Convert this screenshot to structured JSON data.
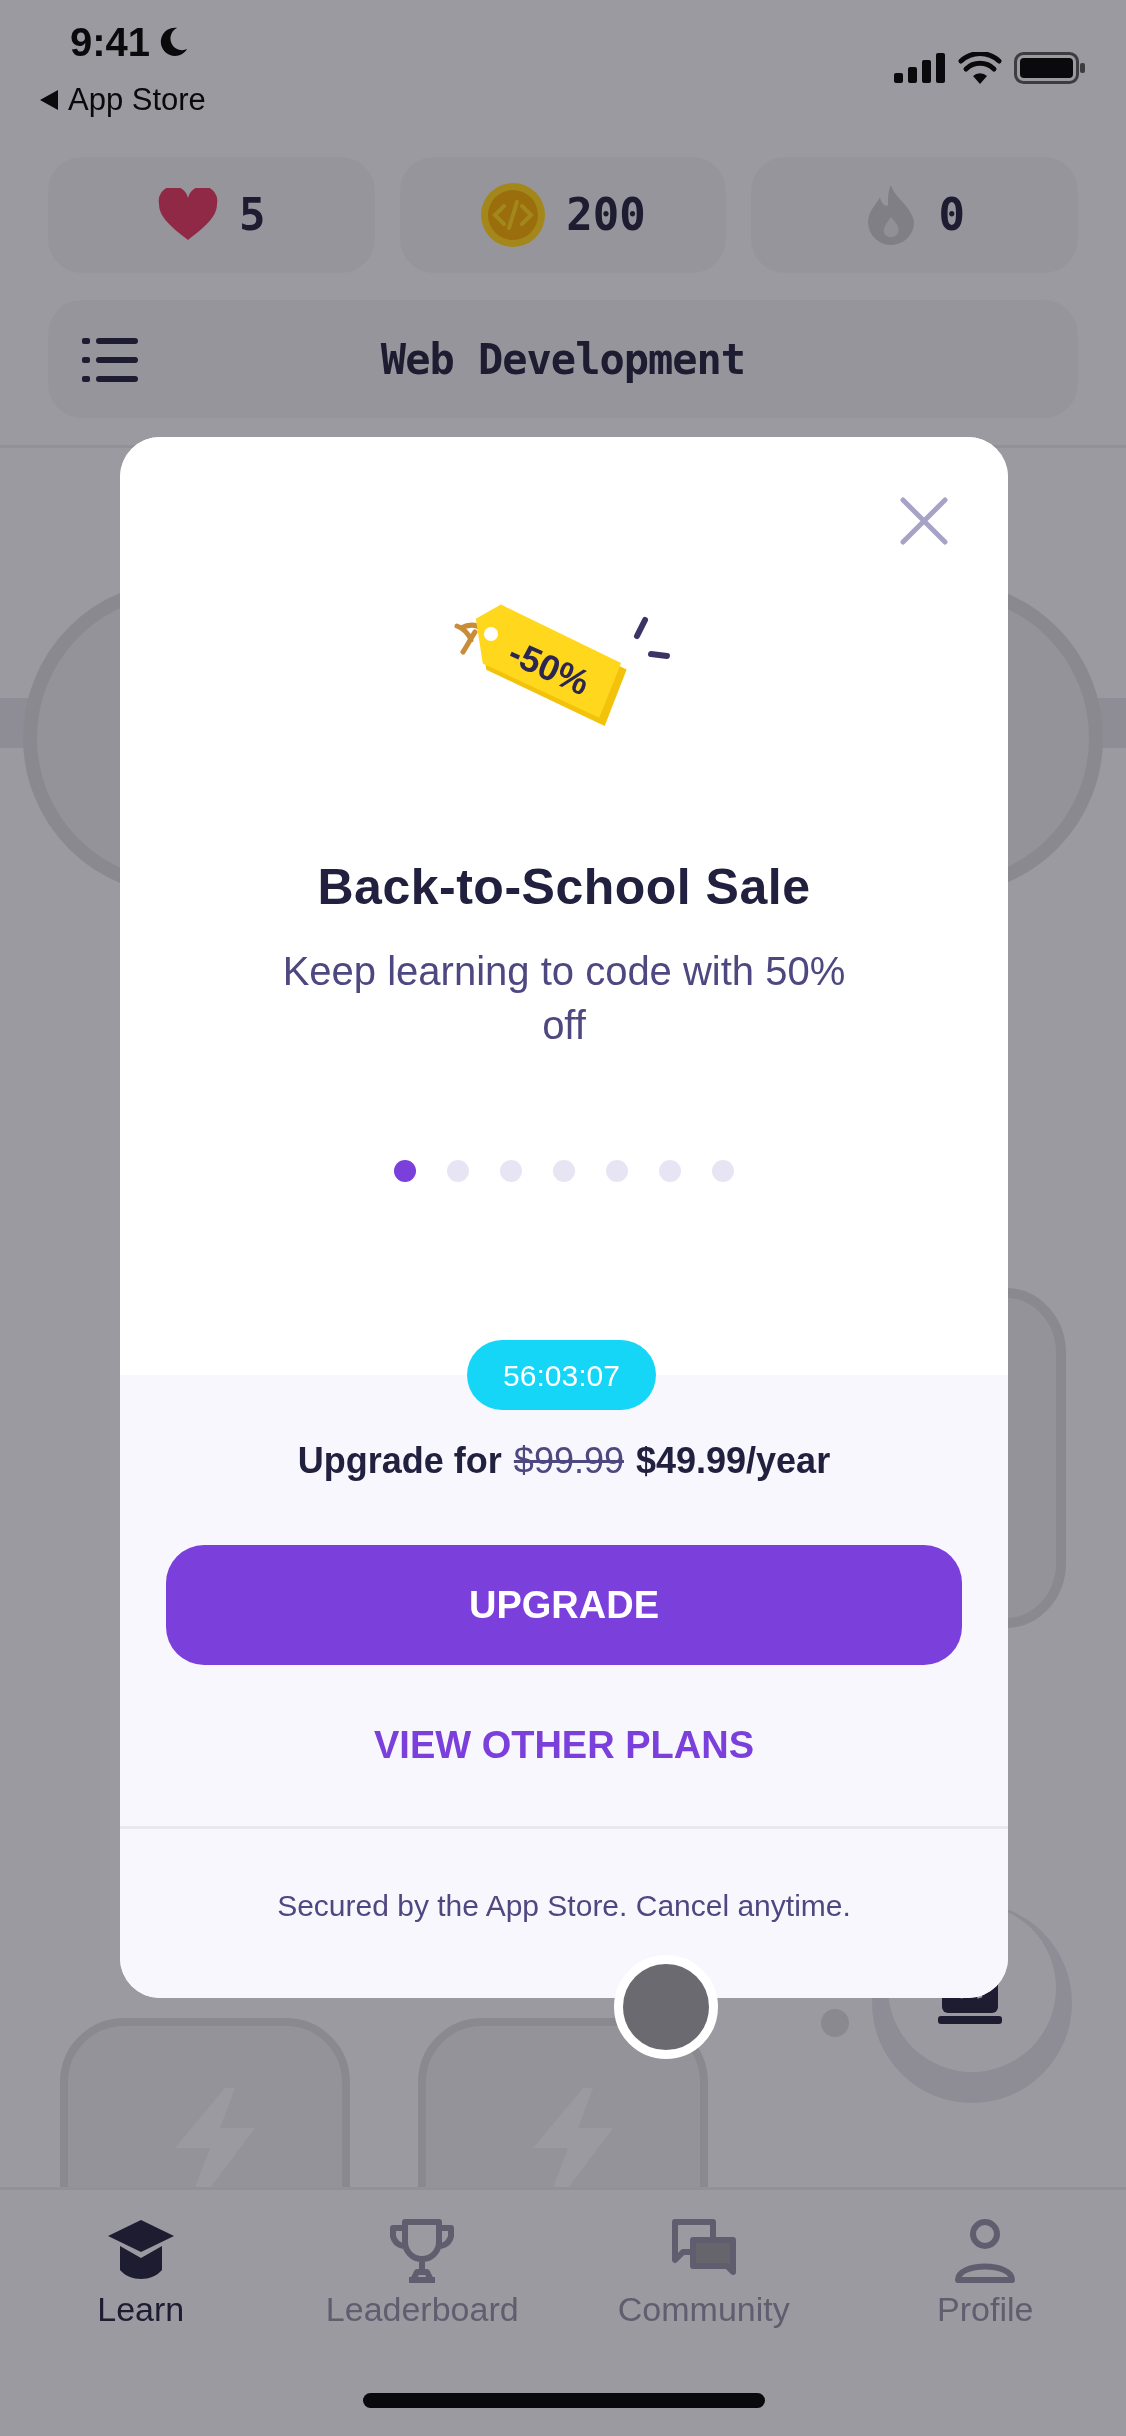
{
  "status_bar": {
    "time": "9:41",
    "back_label": "App Store"
  },
  "stats": [
    {
      "kind": "hearts",
      "value": "5"
    },
    {
      "kind": "coins",
      "value": "200"
    },
    {
      "kind": "streak",
      "value": "0"
    }
  ],
  "course_bar": {
    "title": "Web Development"
  },
  "modal": {
    "tag_label": "-50%",
    "title": "Back-to-School Sale",
    "subtitle": "Keep learning to code with 50% off",
    "pages": [
      {
        "selected": true
      },
      {
        "selected": false
      },
      {
        "selected": false
      },
      {
        "selected": false
      },
      {
        "selected": false
      },
      {
        "selected": false
      },
      {
        "selected": false
      }
    ],
    "timer": "56:03:07",
    "price_prefix": "Upgrade for",
    "old_price": "$99.99",
    "new_price": "$49.99/year",
    "primary_button": "UPGRADE",
    "secondary_button": "VIEW OTHER PLANS",
    "footnote": "Secured by the App Store. Cancel anytime."
  },
  "tab_bar": [
    {
      "kind": "learn",
      "label": "Learn",
      "selected": true
    },
    {
      "kind": "leaderboard",
      "label": "Leaderboard",
      "selected": false
    },
    {
      "kind": "community",
      "label": "Community",
      "selected": false
    },
    {
      "kind": "profile",
      "label": "Profile",
      "selected": false
    }
  ]
}
